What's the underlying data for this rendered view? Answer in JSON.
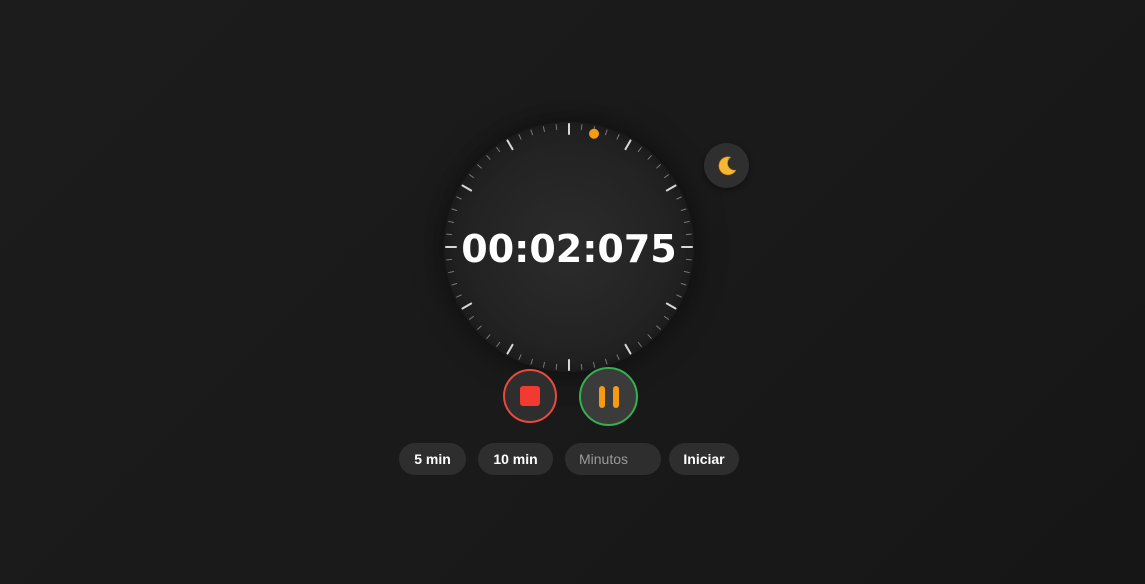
{
  "timer": {
    "display": "00:02:075",
    "progress_fraction": 0.0346
  },
  "dial": {
    "tick_count": 60,
    "indicator_color": "#f59a12"
  },
  "theme_toggle": {
    "icon": "moon-icon",
    "glyph": "🌙"
  },
  "controls": {
    "stop": {
      "icon": "stop-icon",
      "border_color": "#e84a3e",
      "fill_color": "#f23a30"
    },
    "pause": {
      "icon": "pause-icon",
      "border_color": "#35b04f",
      "fill_color": "#f59a12"
    }
  },
  "presets": {
    "five_label": "5 min",
    "ten_label": "10 min"
  },
  "custom": {
    "input_placeholder": "Minutos",
    "input_value": "",
    "start_label": "Iniciar"
  },
  "colors": {
    "background": "#1a1a1a",
    "surface": "#2e2e2e",
    "text": "#ffffff"
  }
}
